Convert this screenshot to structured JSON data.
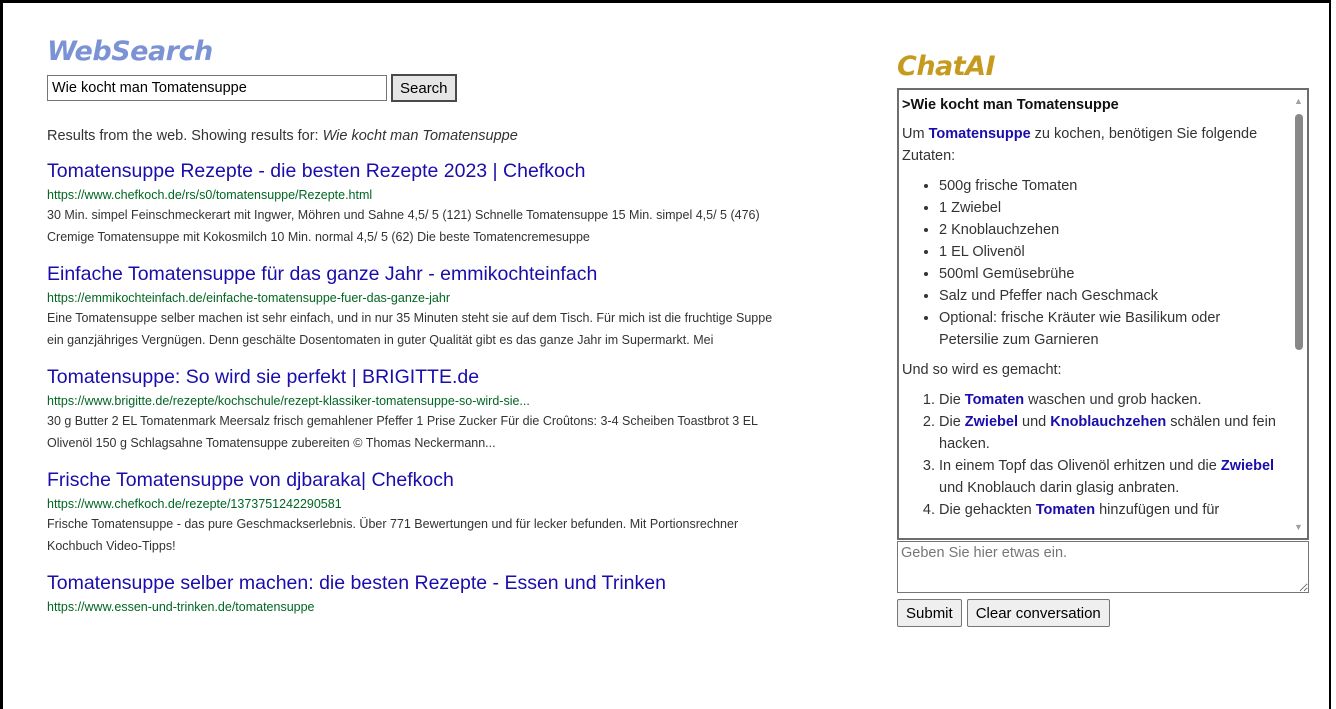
{
  "colors": {
    "websearch_brand": "#7b93d4",
    "chatai_brand": "#c59a1e",
    "link": "#1a0dab",
    "url": "#006621"
  },
  "search": {
    "brand": "WebSearch",
    "query_value": "Wie kocht man Tomatensuppe",
    "button_label": "Search",
    "showing_prefix": "Results from the web. Showing results for:",
    "showing_query": "Wie kocht man Tomatensuppe"
  },
  "results": [
    {
      "title": "Tomatensuppe Rezepte - die besten Rezepte 2023 | Chefkoch",
      "url": "https://www.chefkoch.de/rs/s0/tomatensuppe/Rezepte.html",
      "snippet": "30 Min. simpel Feinschmeckerart mit Ingwer, Möhren und Sahne 4,5/ 5 (121) Schnelle Tomatensuppe 15 Min. simpel 4,5/ 5 (476) Cremige Tomatensuppe mit Kokosmilch 10 Min. normal 4,5/ 5 (62) Die beste Tomatencremesuppe"
    },
    {
      "title": "Einfache Tomatensuppe für das ganze Jahr - emmikochteinfach",
      "url": "https://emmikochteinfach.de/einfache-tomatensuppe-fuer-das-ganze-jahr",
      "snippet": "Eine Tomatensuppe selber machen ist sehr einfach, und in nur 35 Minuten steht sie auf dem Tisch. Für mich ist die fruchtige Suppe ein ganzjähriges Vergnügen. Denn geschälte Dosentomaten in guter Qualität gibt es das ganze Jahr im Supermarkt. Mei"
    },
    {
      "title": "Tomatensuppe: So wird sie perfekt | BRIGITTE.de",
      "url": "https://www.brigitte.de/rezepte/kochschule/rezept-klassiker-tomatensuppe-so-wird-sie...",
      "snippet": "30 g Butter 2 EL Tomatenmark Meersalz frisch gemahlener Pfeffer 1 Prise Zucker Für die Croûtons: 3-4 Scheiben Toastbrot 3 EL Olivenöl 150 g Schlagsahne Tomatensuppe zubereiten © Thomas Neckermann..."
    },
    {
      "title": "Frische Tomatensuppe von djbaraka| Chefkoch",
      "url": "https://www.chefkoch.de/rezepte/1373751242290581",
      "snippet": "Frische Tomatensuppe - das pure Geschmackserlebnis. Über 771 Bewertungen und für lecker befunden. Mit Portionsrechner Kochbuch Video-Tipps!"
    },
    {
      "title": "Tomatensuppe selber machen: die besten Rezepte - Essen und Trinken",
      "url": "https://www.essen-und-trinken.de/tomatensuppe",
      "snippet": ""
    }
  ],
  "chat": {
    "brand": "ChatAI",
    "user_query": ">Wie kocht man Tomatensuppe",
    "intro_before": "Um ",
    "intro_kw": "Tomatensuppe",
    "intro_after": " zu kochen, benötigen Sie folgende Zutaten:",
    "ingredients": [
      "500g frische Tomaten",
      "1 Zwiebel",
      "2 Knoblauchzehen",
      "1 EL Olivenöl",
      "500ml Gemüsebrühe",
      "Salz und Pfeffer nach Geschmack",
      "Optional: frische Kräuter wie Basilikum oder Petersilie zum Garnieren"
    ],
    "steps_intro": "Und so wird es gemacht:",
    "steps": {
      "s1_a": "Die ",
      "s1_kw": "Tomaten",
      "s1_b": " waschen und grob hacken.",
      "s2_a": "Die ",
      "s2_kw1": "Zwiebel",
      "s2_b": " und ",
      "s2_kw2": "Knoblauchzehen",
      "s2_c": " schälen und fein hacken.",
      "s3_a": "In einem Topf das Olivenöl erhitzen und die ",
      "s3_kw": "Zwiebel",
      "s3_b": " und Knoblauch darin glasig anbraten.",
      "s4_a": "Die gehackten ",
      "s4_kw": "Tomaten",
      "s4_b": " hinzufügen und für"
    },
    "input_placeholder": "Geben Sie hier etwas ein.",
    "submit_label": "Submit",
    "clear_label": "Clear conversation"
  }
}
